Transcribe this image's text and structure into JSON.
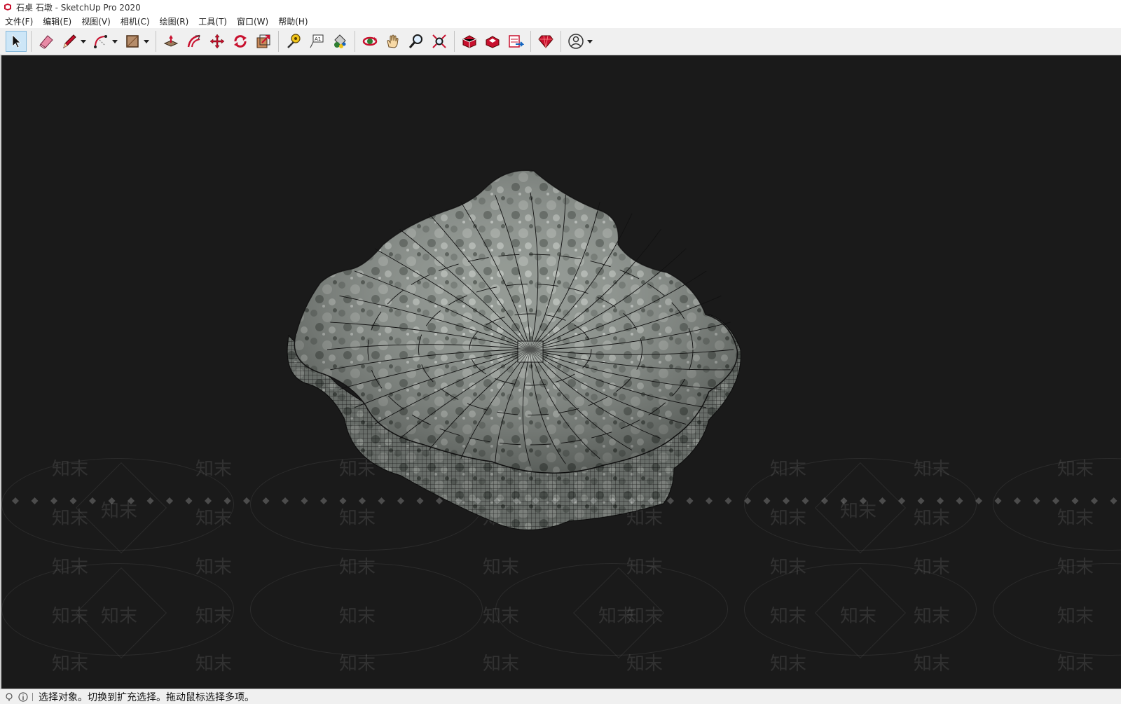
{
  "window": {
    "title": "石桌 石墩 - SketchUp Pro 2020",
    "app_icon": "sketchup-logo-icon"
  },
  "menu": {
    "items": [
      "文件(F)",
      "编辑(E)",
      "视图(V)",
      "相机(C)",
      "绘图(R)",
      "工具(T)",
      "窗口(W)",
      "帮助(H)"
    ]
  },
  "toolbar": {
    "tools": [
      "select-tool-icon",
      "eraser-tool-icon",
      "line-tool-icon",
      "arc-tool-icon",
      "rectangle-tool-icon",
      "push-pull-tool-icon",
      "offset-tool-icon",
      "move-tool-icon",
      "rotate-tool-icon",
      "scale-tool-icon",
      "tape-measure-tool-icon",
      "text-tool-icon",
      "paint-bucket-tool-icon",
      "orbit-tool-icon",
      "pan-tool-icon",
      "zoom-tool-icon",
      "zoom-extents-tool-icon",
      "3d-warehouse-icon",
      "extension-warehouse-icon",
      "layout-send-icon",
      "extension-manager-icon",
      "account-icon"
    ],
    "active_tool": "select-tool-icon"
  },
  "viewport": {
    "background": "#1a1a1a",
    "model": "stone-stool-mesh",
    "watermark_text": "知末"
  },
  "statusbar": {
    "hint": "选择对象。切换到扩充选择。拖动鼠标选择多项。"
  },
  "colors": {
    "accent_select": "#cde6f7",
    "stone_light": "#8e958f",
    "stone_dark": "#4c524d",
    "wire": "#111111",
    "sketchup_red": "#c8102e"
  }
}
